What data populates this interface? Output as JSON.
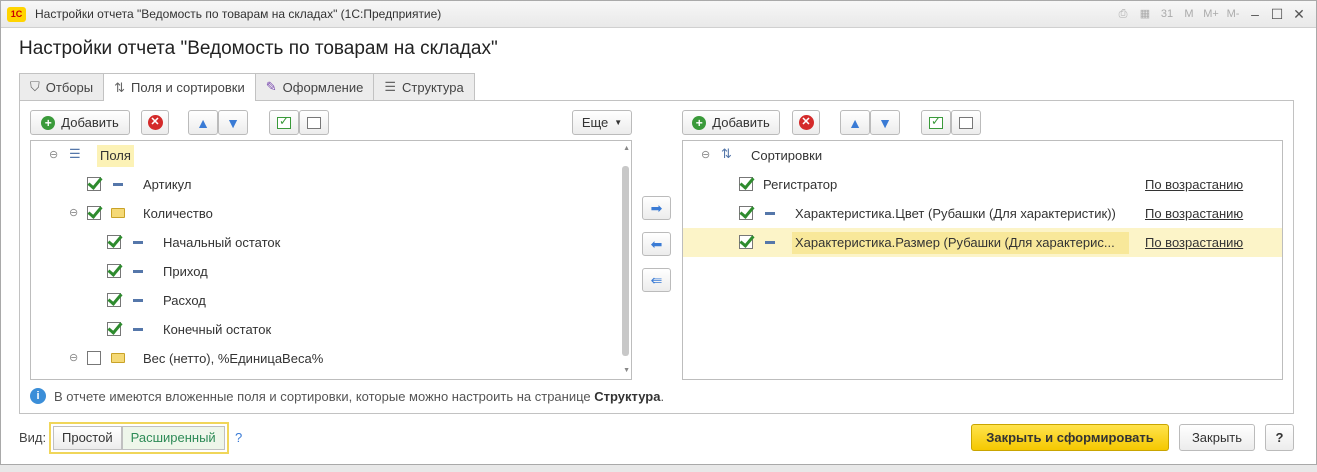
{
  "window": {
    "title": "Настройки отчета \"Ведомость по товарам на складах\"  (1С:Предприятие)",
    "app_badge": "1С",
    "titlebar_icons": [
      "print-icon",
      "calendar-icon",
      "calendar-31-icon",
      "M",
      "M+",
      "M-",
      "minimize-icon",
      "maximize-icon",
      "close-icon"
    ],
    "calendar_day": "31",
    "mem_labels": [
      "M",
      "M+",
      "M-"
    ]
  },
  "form": {
    "title": "Настройки отчета \"Ведомость по товарам на складах\""
  },
  "tabs": [
    {
      "label": "Отборы",
      "icon": "filter-icon",
      "active": false
    },
    {
      "label": "Поля и сортировки",
      "icon": "fields-sort-icon",
      "active": true
    },
    {
      "label": "Оформление",
      "icon": "brush-icon",
      "active": false
    },
    {
      "label": "Структура",
      "icon": "structure-icon",
      "active": false
    }
  ],
  "left_toolbar": {
    "add_label": "Добавить",
    "more_label": "Еще"
  },
  "right_toolbar": {
    "add_label": "Добавить"
  },
  "fields_tree": {
    "root_label": "Поля",
    "items": [
      {
        "label": "Артикул",
        "checked": true
      },
      {
        "label": "Количество",
        "checked": true
      },
      {
        "label": "Начальный остаток",
        "checked": true
      },
      {
        "label": "Приход",
        "checked": true
      },
      {
        "label": "Расход",
        "checked": true
      },
      {
        "label": "Конечный остаток",
        "checked": true
      },
      {
        "label": "Вес (нетто), %ЕдиницаВеса%",
        "checked": false
      }
    ]
  },
  "sort_tree": {
    "root_label": "Сортировки",
    "items": [
      {
        "label": "Регистратор",
        "direction": "По возрастанию",
        "checked": true
      },
      {
        "label": "Характеристика.Цвет (Рубашки (Для характеристик))",
        "direction": "По возрастанию",
        "checked": true
      },
      {
        "label": "Характеристика.Размер (Рубашки (Для характерис...",
        "direction": "По возрастанию",
        "checked": true,
        "selected": true
      }
    ]
  },
  "info": {
    "text": "В отчете имеются вложенные поля и сортировки, которые можно настроить на странице",
    "link": "Структура",
    "end": "."
  },
  "footer": {
    "vid_label": "Вид:",
    "simple": "Простой",
    "extended": "Расширенный",
    "help_q": "?",
    "run_label": "Закрыть и сформировать",
    "close_label": "Закрыть",
    "help_label": "?"
  },
  "colors": {
    "accent_yellow": "#f5c800",
    "selected_row": "#fcf4c8",
    "green_check": "#2e8b2e"
  }
}
